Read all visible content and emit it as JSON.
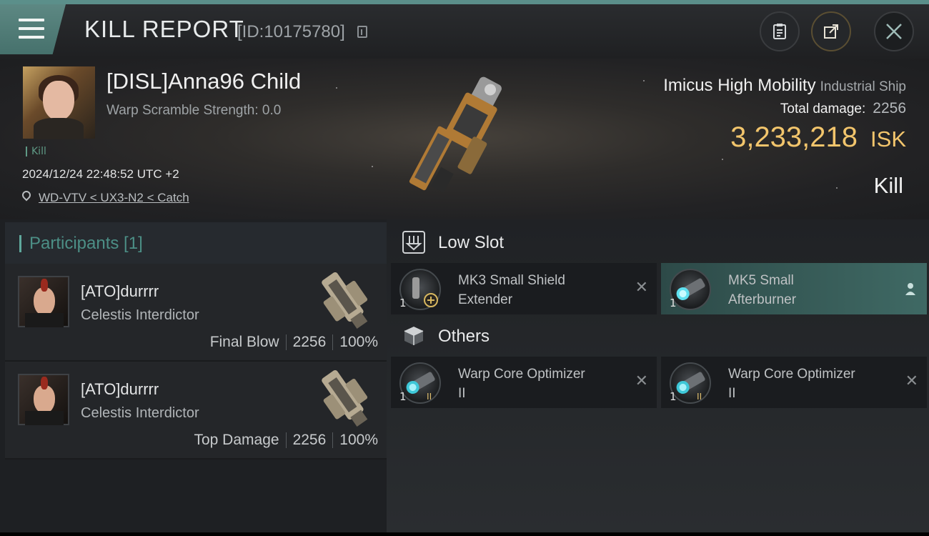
{
  "header": {
    "title": "KILL REPORT",
    "report_id": "[ID:10175780]"
  },
  "victim": {
    "pilot_name": "[DISL]Anna96 Child",
    "warp_scramble": "Warp Scramble Strength: 0.0",
    "kill_tag": "Kill",
    "datetime": "2024/12/24 22:48:52 UTC +2",
    "location": "WD-VTV < UX3-N2 < Catch",
    "ship_name": "Imicus High Mobility",
    "ship_class": "Industrial Ship",
    "total_damage_label": "Total damage:",
    "total_damage": "2256",
    "isk_value": "3,233,218",
    "isk_unit": "ISK",
    "result": "Kill"
  },
  "participants": {
    "title": "Participants [1]",
    "rows": [
      {
        "name": "[ATO]durrrr",
        "ship": "Celestis Interdictor",
        "role": "Final Blow",
        "damage": "2256",
        "percent": "100%"
      },
      {
        "name": "[ATO]durrrr",
        "ship": "Celestis Interdictor",
        "role": "Top Damage",
        "damage": "2256",
        "percent": "100%"
      }
    ]
  },
  "slots": {
    "low_slot_title": "Low Slot",
    "others_title": "Others",
    "low_items": [
      {
        "qty": "1",
        "name_line1": "MK3 Small Shield",
        "name_line2": "Extender",
        "status": "destroyed"
      },
      {
        "qty": "1",
        "name_line1": "MK5 Small",
        "name_line2": "Afterburner",
        "status": "dropped"
      }
    ],
    "other_items": [
      {
        "qty": "1",
        "name_line1": "Warp Core Optimizer",
        "name_line2": "II",
        "badge": "II",
        "status": "destroyed"
      },
      {
        "qty": "1",
        "name_line1": "Warp Core Optimizer",
        "name_line2": "II",
        "badge": "II",
        "status": "destroyed"
      }
    ]
  },
  "colors": {
    "accent": "#5b8f8a",
    "isk": "#f2c56c",
    "kill_tag": "#5f9a86"
  },
  "icons": [
    "menu-icon",
    "copy-icon",
    "clipboard-icon",
    "share-icon",
    "close-icon",
    "location-pin-icon",
    "low-slot-icon",
    "others-icon",
    "destroyed-x-icon",
    "person-icon"
  ]
}
